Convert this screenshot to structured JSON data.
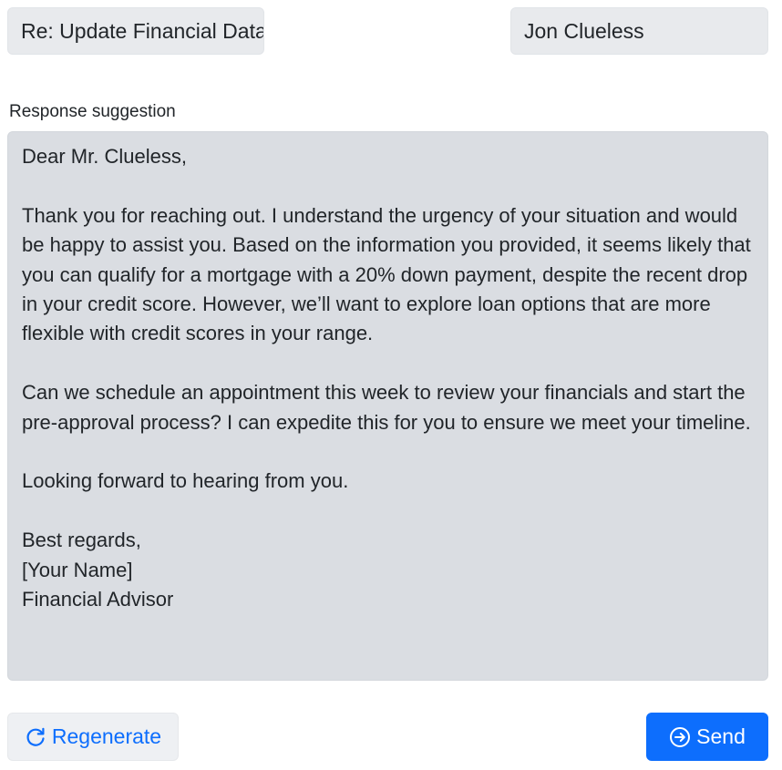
{
  "email": {
    "subject_value": "Re: Update Financial Data",
    "recipient_value": "Jon Clueless"
  },
  "response": {
    "label": "Response suggestion",
    "text": "Dear Mr. Clueless,\n\nThank you for reaching out. I understand the urgency of your situation and would be happy to assist you. Based on the information you provided, it seems likely that you can qualify for a mortgage with a 20% down payment, despite the recent drop in your credit score. However, we’ll want to explore loan options that are more flexible with credit scores in your range.\n\nCan we schedule an appointment this week to review your financials and start the pre-approval process? I can expedite this for you to ensure we meet your timeline.\n\nLooking forward to hearing from you.\n\nBest regards,\n[Your Name]\nFinancial Advisor"
  },
  "actions": {
    "regenerate_label": "Regenerate",
    "regenerate_icon": "refresh-icon",
    "send_label": "Send",
    "send_icon": "arrow-right-circle-icon"
  },
  "colors": {
    "accent": "#0d6efd",
    "field_bg": "#e8eaed",
    "response_bg": "#dadde2"
  }
}
